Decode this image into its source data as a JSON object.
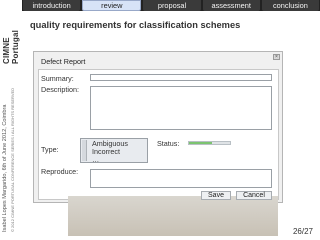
{
  "nav": {
    "tabs": [
      {
        "label": "introduction"
      },
      {
        "label": "review"
      },
      {
        "label": "proposal"
      },
      {
        "label": "assessment"
      },
      {
        "label": "conclusion"
      }
    ]
  },
  "side": {
    "logo_text": "CIMNE Portugal",
    "credit_line1": "Isabel Lopes Margarido, 6th of June 2012, Coimbra",
    "credit_line2": "© 2012 CIMNE PORTUGAL CONFERENCE SERIES / ALL RIGHTS RESERVED"
  },
  "page": {
    "title": "quality requirements for classification schemes",
    "page_number": "26/27"
  },
  "dialog": {
    "title": "Defect Report",
    "close_icon": "close-icon",
    "summary_label": "Summary:",
    "description_label": "Description:",
    "type_label": "Type:",
    "type_options": [
      "Ambiguous",
      "Incorrect",
      "…"
    ],
    "status_label": "Status:",
    "status_progress": 0.55,
    "status_color": "#7cc470",
    "reproduce_label": "Reproduce:",
    "save_label": "Save",
    "cancel_label": "Cancel"
  },
  "colors": {
    "nav_bg": "#222222",
    "tab_bg": "#3a3a3a",
    "tab_active": "#d7e3f7"
  }
}
